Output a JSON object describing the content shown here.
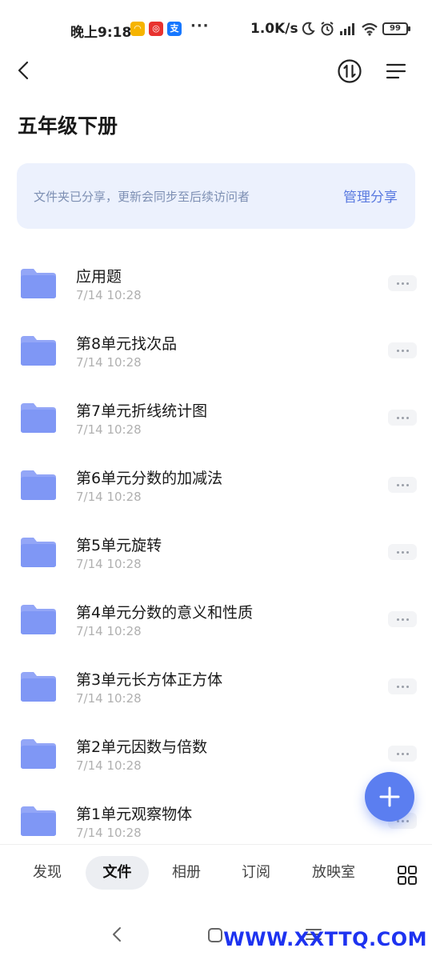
{
  "status_bar": {
    "time": "晚上9:18",
    "dots": "···",
    "speed": "1.0K/s",
    "battery": "99"
  },
  "header": {
    "title": "五年级下册"
  },
  "share_banner": {
    "text": "文件夹已分享，更新会同步至后续访问者",
    "action": "管理分享"
  },
  "files": [
    {
      "name": "应用题",
      "date": "7/14 10:28"
    },
    {
      "name": "第8单元找次品",
      "date": "7/14 10:28"
    },
    {
      "name": "第7单元折线统计图",
      "date": "7/14 10:28"
    },
    {
      "name": "第6单元分数的加减法",
      "date": "7/14 10:28"
    },
    {
      "name": "第5单元旋转",
      "date": "7/14 10:28"
    },
    {
      "name": "第4单元分数的意义和性质",
      "date": "7/14 10:28"
    },
    {
      "name": "第3单元长方体正方体",
      "date": "7/14 10:28"
    },
    {
      "name": "第2单元因数与倍数",
      "date": "7/14 10:28"
    },
    {
      "name": "第1单元观察物体",
      "date": "7/14 10:28"
    }
  ],
  "tabs": [
    {
      "label": "发现"
    },
    {
      "label": "文件"
    },
    {
      "label": "相册"
    },
    {
      "label": "订阅"
    },
    {
      "label": "放映室"
    }
  ],
  "watermark": "WWW.XXTTQ.COM",
  "colors": {
    "accent": "#5b7ef0",
    "banner_bg": "#ecf1fd",
    "folder": "#7f97f5"
  }
}
